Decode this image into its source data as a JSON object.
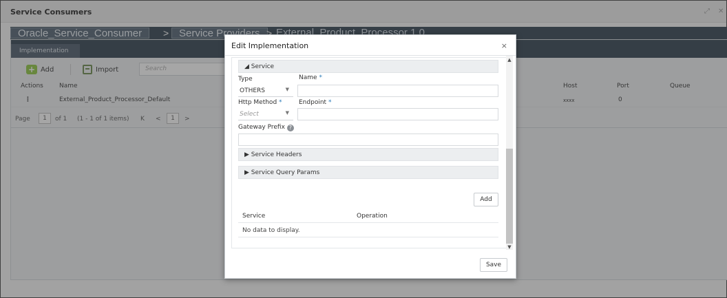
{
  "window": {
    "title": "Service Consumers"
  },
  "breadcrumb": {
    "item1": "Oracle_Service_Consumer",
    "item2": "Service Providers",
    "item3": "External_Product_Processor 1.0",
    "sep": ">"
  },
  "tabs": {
    "active": "Implementation"
  },
  "toolbar": {
    "add_label": "Add",
    "import_label": "Import",
    "search_placeholder": "Search"
  },
  "grid": {
    "headers": {
      "actions": "Actions",
      "name": "Name",
      "host": "Host",
      "port": "Port",
      "queue": "Queue"
    },
    "row": {
      "actions": "⋮",
      "name": "External_Product_Processor_Default",
      "host": "xxxx",
      "port": "0",
      "queue": ""
    }
  },
  "pager": {
    "page_label": "Page",
    "page_value": "1",
    "of_text": "of 1",
    "items_text": "(1 - 1 of 1 items)",
    "first": "K",
    "prev": "<",
    "current": "1",
    "next": ">"
  },
  "modal": {
    "title": "Edit Implementation",
    "close": "×",
    "service_section": "Service",
    "type_label": "Type",
    "type_value": "OTHERS",
    "name_label": "Name",
    "http_method_label": "Http Method",
    "http_method_placeholder": "Select",
    "endpoint_label": "Endpoint",
    "gateway_prefix_label": "Gateway Prefix",
    "headers_section": "Service Headers",
    "query_params_section": "Service Query Params",
    "add_button": "Add",
    "table_headers": {
      "service": "Service",
      "operation": "Operation"
    },
    "empty_text": "No data to display.",
    "save_button": "Save",
    "required_mark": "*"
  }
}
